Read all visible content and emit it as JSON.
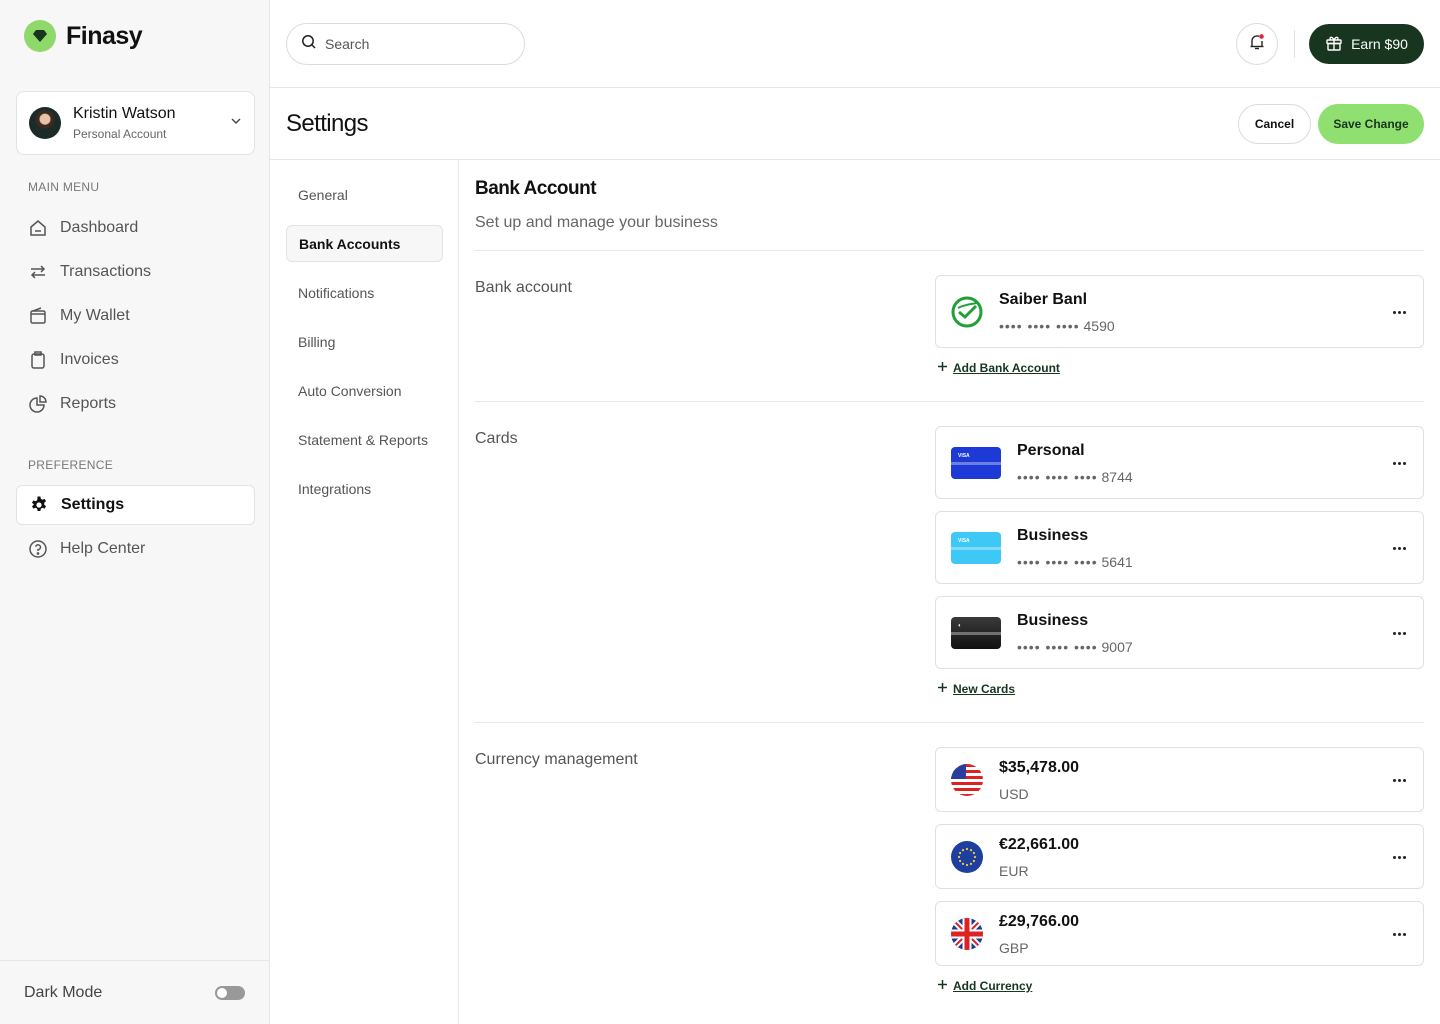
{
  "brand": {
    "name": "Finasy"
  },
  "account": {
    "name": "Kristin Watson",
    "type": "Personal Account"
  },
  "sidebar": {
    "main_label": "MAIN MENU",
    "main_items": [
      {
        "label": "Dashboard",
        "icon": "home-icon"
      },
      {
        "label": "Transactions",
        "icon": "arrows-icon"
      },
      {
        "label": "My Wallet",
        "icon": "wallet-icon"
      },
      {
        "label": "Invoices",
        "icon": "clipboard-icon"
      },
      {
        "label": "Reports",
        "icon": "pie-chart-icon"
      }
    ],
    "pref_label": "PREFERENCE",
    "pref_items": [
      {
        "label": "Settings",
        "icon": "gear-icon",
        "active": true
      },
      {
        "label": "Help Center",
        "icon": "help-icon"
      }
    ],
    "dark_mode_label": "Dark Mode",
    "dark_mode_on": false
  },
  "topbar": {
    "search_placeholder": "Search",
    "earn_label": "Earn $90"
  },
  "page": {
    "title": "Settings",
    "cancel_label": "Cancel",
    "save_label": "Save Change"
  },
  "subnav": [
    "General",
    "Bank Accounts",
    "Notifications",
    "Billing",
    "Auto Conversion",
    "Statement & Reports",
    "Integrations"
  ],
  "subnav_active": "Bank Accounts",
  "content": {
    "title": "Bank Account",
    "subtitle": "Set up and manage your business",
    "bank_section": {
      "label": "Bank account",
      "accounts": [
        {
          "name": "Saiber Banl",
          "masked": "•••• •••• ••••",
          "last4": "4590"
        }
      ],
      "add_label": "Add Bank Account"
    },
    "cards_section": {
      "label": "Cards",
      "cards": [
        {
          "name": "Personal",
          "masked": "•••• •••• ••••",
          "last4": "8744",
          "color": "#1d3ad6",
          "brand": "VISA"
        },
        {
          "name": "Business",
          "masked": "•••• •••• ••••",
          "last4": "5641",
          "color": "#3ec8f5",
          "brand": "VISA"
        },
        {
          "name": "Business",
          "masked": "•••• •••• ••••",
          "last4": "9007",
          "color": "#222222",
          "brand": ""
        }
      ],
      "add_label": "New Cards"
    },
    "currency_section": {
      "label": "Currency management",
      "currencies": [
        {
          "amount": "$35,478.00",
          "code": "USD",
          "flag": "us-flag-icon"
        },
        {
          "amount": "€22,661.00",
          "code": "EUR",
          "flag": "eu-flag-icon"
        },
        {
          "amount": "£29,766.00",
          "code": "GBP",
          "flag": "uk-flag-icon"
        }
      ],
      "add_label": "Add Currency"
    }
  },
  "colors": {
    "accent": "#8fe070",
    "dark_green": "#17351f",
    "sidebar_bg": "#f7f7f7"
  }
}
